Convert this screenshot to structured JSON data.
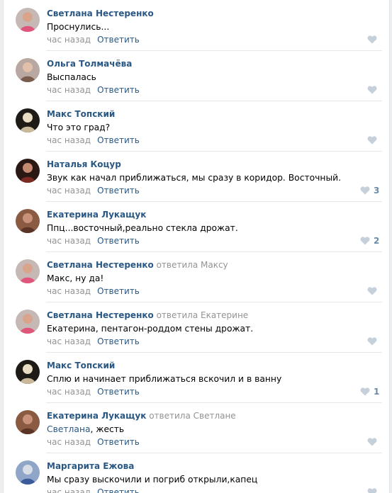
{
  "comments": [
    {
      "author": "Светлана Нестеренко",
      "replied": "",
      "mention": "",
      "text": "Проснулись...",
      "time": "час назад",
      "reply_label": "Ответить",
      "likes": "",
      "avatar": {
        "bg": "#c6b8b4",
        "fg": "#e0557a",
        "skin": "#d9a48c"
      }
    },
    {
      "author": "Ольга Толмачёва",
      "replied": "",
      "mention": "",
      "text": "Выспалась",
      "time": "час назад",
      "reply_label": "Ответить",
      "likes": "",
      "avatar": {
        "bg": "#b9a7a1",
        "fg": "#7a5c4e",
        "skin": "#e3c0ac"
      }
    },
    {
      "author": "Макс Топский",
      "replied": "",
      "mention": "",
      "text": "Что это град?",
      "time": "час назад",
      "reply_label": "Ответить",
      "likes": "",
      "avatar": {
        "bg": "#1e1a16",
        "fg": "#c9b89a",
        "skin": "#e8dcc2"
      }
    },
    {
      "author": "Наталья Коцур",
      "replied": "",
      "mention": "",
      "text": "Звук как начал приближаться, мы сразу в коридор. Восточный.",
      "time": "час назад",
      "reply_label": "Ответить",
      "likes": "3",
      "avatar": {
        "bg": "#2a1814",
        "fg": "#7a2a22",
        "skin": "#c58a72"
      }
    },
    {
      "author": "Екатерина Лукащук",
      "replied": "",
      "mention": "",
      "text": "Ппц...восточный,реально стекла дрожат.",
      "time": "час назад",
      "reply_label": "Ответить",
      "likes": "2",
      "avatar": {
        "bg": "#8a5a42",
        "fg": "#5a3424",
        "skin": "#c99278"
      }
    },
    {
      "author": "Светлана Нестеренко",
      "replied": "ответила Максу",
      "mention": "",
      "text": "Макс, ну да!",
      "time": "час назад",
      "reply_label": "Ответить",
      "likes": "",
      "avatar": {
        "bg": "#c6b8b4",
        "fg": "#e0557a",
        "skin": "#d9a48c"
      }
    },
    {
      "author": "Светлана Нестеренко",
      "replied": "ответила Екатерине",
      "mention": "",
      "text": "Екатерина, пентагон-роддом стены дрожат.",
      "time": "час назад",
      "reply_label": "Ответить",
      "likes": "",
      "avatar": {
        "bg": "#c6b8b4",
        "fg": "#e0557a",
        "skin": "#d9a48c"
      }
    },
    {
      "author": "Макс Топский",
      "replied": "",
      "mention": "",
      "text": "Сплю и начинает приближаться вскочил и в ванну",
      "time": "час назад",
      "reply_label": "Ответить",
      "likes": "1",
      "avatar": {
        "bg": "#1e1a16",
        "fg": "#c9b89a",
        "skin": "#e8dcc2"
      }
    },
    {
      "author": "Екатерина Лукащук",
      "replied": "ответила Светлане",
      "mention": "Светлана",
      "text": ", жесть",
      "time": "час назад",
      "reply_label": "Ответить",
      "likes": "",
      "avatar": {
        "bg": "#8a5a42",
        "fg": "#5a3424",
        "skin": "#c99278"
      }
    },
    {
      "author": "Маргарита Ежова",
      "replied": "",
      "mention": "",
      "text": "Мы сразу выскочили и погриб открыли,капец",
      "time": "час назад",
      "reply_label": "Ответить",
      "likes": "",
      "avatar": {
        "bg": "#8fa6c8",
        "fg": "#3a5a9a",
        "skin": "#d8dde6"
      }
    }
  ],
  "colors": {
    "link": "#2a5885",
    "muted": "#939393",
    "like_icon": "#c5d0db"
  }
}
